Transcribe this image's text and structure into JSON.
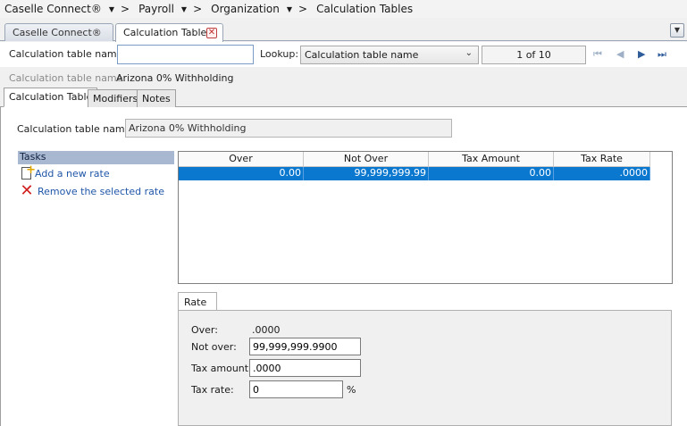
{
  "breadcrumb": {
    "items": [
      "Caselle Connect®",
      "Payroll",
      "Organization",
      "Calculation Tables"
    ]
  },
  "tabs": {
    "inactive_label": "Caselle Connect®",
    "active_label": "Calculation Tables"
  },
  "lookup": {
    "name_label": "Calculation table name:",
    "name_value": "",
    "lookup_label": "Lookup:",
    "lookup_selected": "Calculation table name",
    "pager_text": "1 of 10"
  },
  "record": {
    "name_label": "Calculation table name:",
    "name_value": "Arizona 0% Withholding"
  },
  "inner_tabs": [
    "Calculation Table",
    "Modifiers",
    "Notes"
  ],
  "form": {
    "name_label": "Calculation table name:",
    "name_value": "Arizona 0% Withholding"
  },
  "tasks": {
    "header": "Tasks",
    "add_label": "Add a new rate",
    "remove_label": "Remove the selected rate"
  },
  "grid": {
    "columns": [
      "Over",
      "Not Over",
      "Tax Amount",
      "Tax Rate"
    ],
    "rows": [
      [
        "0.00",
        "99,999,999.99",
        "0.00",
        ".0000"
      ]
    ]
  },
  "rate": {
    "tab_label": "Rate",
    "over_label": "Over:",
    "over_value": ".0000",
    "not_over_label": "Not over:",
    "not_over_value": "99,999,999.9900",
    "tax_amount_label": "Tax amount:",
    "tax_amount_value": ".0000",
    "tax_rate_label": "Tax rate:",
    "tax_rate_value": "0",
    "pct_symbol": "%"
  }
}
